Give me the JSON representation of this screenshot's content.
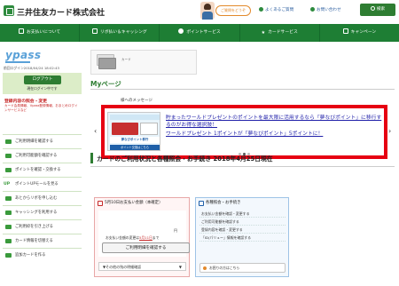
{
  "header": {
    "brand": "三井住友カード株式会社",
    "help_button": "ご質問をどうぞ",
    "faq_link": "よくあるご質問",
    "contact_link": "お問い合わせ",
    "search_button": "検索"
  },
  "nav": {
    "items": [
      {
        "label": "お支払いについて",
        "icon": "card-icon"
      },
      {
        "label": "リボ払い＆キャッシング",
        "icon": "revolving-icon"
      },
      {
        "label": "ポイントサービス",
        "icon": "point-icon"
      },
      {
        "label": "カードサービス",
        "icon": "star-icon"
      },
      {
        "label": "キャンペーン",
        "icon": "gift-icon"
      }
    ]
  },
  "sidebar": {
    "brand": "ypass",
    "last_login": "前回ログイン2018/04/24 18:02:43",
    "logout_button": "ログアウト",
    "login_status": "現在ログイン中です",
    "alert_title": "登録内容の照会・変更",
    "alert_body": "カード会員情報、Vpass登録情報、おまとめログインサービスなど",
    "menu": [
      {
        "label": "ご利用明細を確認する"
      },
      {
        "label": "ご利用可能額を確認する"
      },
      {
        "label": "ポイントを確認・交換する"
      },
      {
        "label": "ポイントUPモールを見る",
        "prefix": "UP"
      },
      {
        "label": "あとからリボを申し込む"
      },
      {
        "label": "キャッシングを利用する"
      },
      {
        "label": "ご利用枠を引き上げる"
      },
      {
        "label": "カード情報を切替える"
      },
      {
        "label": "追加カードを作る"
      }
    ]
  },
  "main": {
    "banner_text": "カード",
    "mypage_title": "Myページ",
    "message_label": "様へのメッセージ",
    "promo": {
      "headline": "貯まったワールドプレゼントのポイントを最大限に活用するなら「夢なびポイント」に移行するのがお得な選択肢！",
      "subline": "ワールドプレゼント 1ポイントが「夢なびポイント」5ポイントに！",
      "image_caption": "夢なびポイント移行",
      "image_button": "ポイント交換はこちら"
    },
    "section_title": "カードのご利用状況と各種照会・お手続き 2018年4月25日現在",
    "payment": {
      "header": "5月10日お支払い金額（本確定）",
      "yen": "円",
      "line_prefix": "お支払い金額の変更は",
      "line_amount": "5月11日",
      "line_suffix": "まで",
      "detail_button": "ご利用明細を確認する",
      "other_info": "その他の残の明細確認"
    },
    "reference": {
      "header": "各種照会・お手続き",
      "items": [
        "お支払い金額を確認・変更する",
        "ご利用可能額を確認する",
        "登録内容を確認・変更する",
        "「ID/パリュー」情報を確認する"
      ],
      "footer": "お困りの方はこちら"
    }
  }
}
